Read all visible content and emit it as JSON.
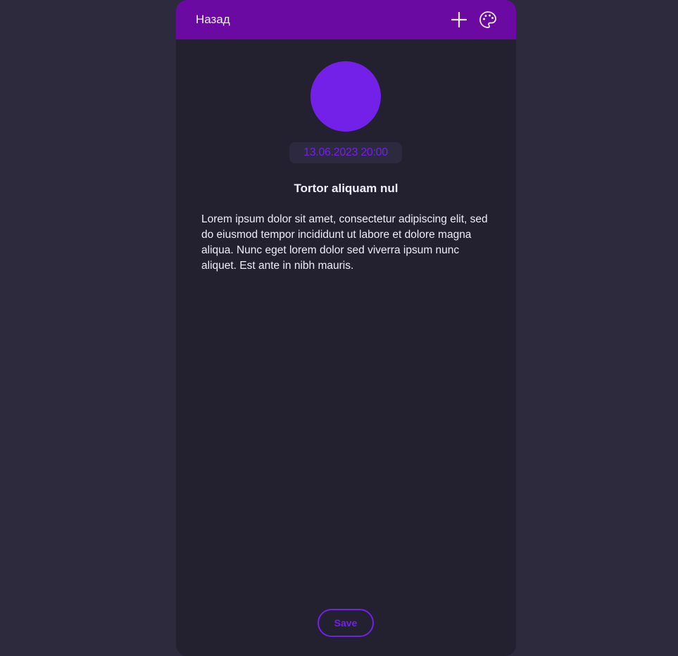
{
  "colors": {
    "background": "#2d2a3e",
    "card": "#232030",
    "appbar": "#6b0aa3",
    "accent": "#7320e8",
    "text": "#f0ecf8"
  },
  "header": {
    "back_label": "Назад",
    "icons": [
      "plus-icon",
      "palette-icon"
    ]
  },
  "note": {
    "avatar_color": "#7320e8",
    "date": "13.06.2023 20:00",
    "title": "Tortor aliquam nul",
    "body": "Lorem ipsum dolor sit amet, consectetur adipiscing elit, sed do eiusmod tempor incididunt ut labore et dolore magna aliqua. Nunc eget lorem dolor sed viverra ipsum nunc aliquet. Est ante in nibh mauris."
  },
  "actions": {
    "save_label": "Save"
  }
}
